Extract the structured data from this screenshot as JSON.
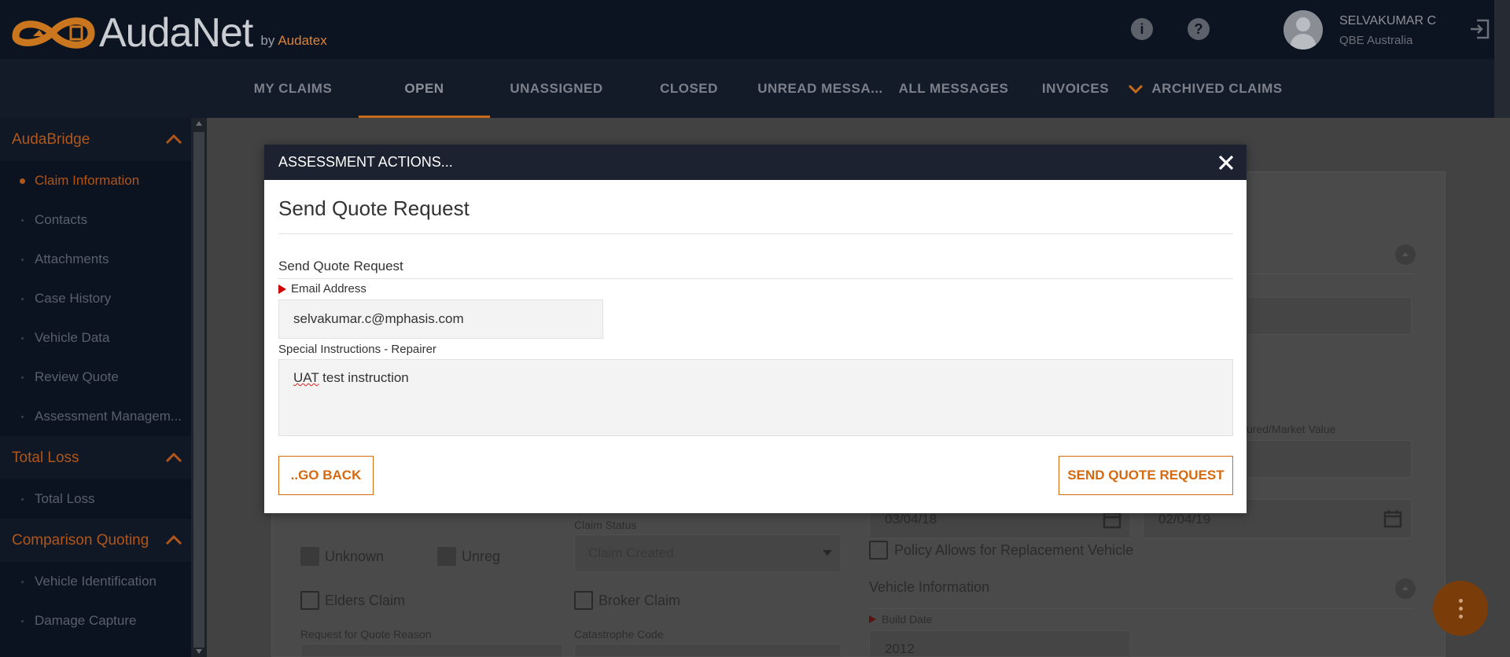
{
  "header": {
    "logo_text": "AudaNet",
    "logo_by": "by",
    "logo_brand": "Audatex",
    "info_icon": "info-icon",
    "help_icon": "help-icon",
    "help_glyph": "?",
    "info_glyph": "i",
    "user_name": "SELVAKUMAR C",
    "user_org": "QBE Australia"
  },
  "nav": {
    "tabs": [
      {
        "label": "MY CLAIMS"
      },
      {
        "label": "OPEN"
      },
      {
        "label": "UNASSIGNED"
      },
      {
        "label": "CLOSED"
      },
      {
        "label": "UNREAD MESSA..."
      },
      {
        "label": "ALL MESSAGES"
      },
      {
        "label": "INVOICES"
      },
      {
        "label": "ARCHIVED CLAIMS"
      }
    ],
    "active_tab": "OPEN"
  },
  "sidebar": {
    "sections": [
      {
        "title": "AudaBridge",
        "items": [
          {
            "label": "Claim Information"
          },
          {
            "label": "Contacts"
          },
          {
            "label": "Attachments"
          },
          {
            "label": "Case History"
          },
          {
            "label": "Vehicle Data"
          },
          {
            "label": "Review Quote"
          },
          {
            "label": "Assessment Managem..."
          }
        ]
      },
      {
        "title": "Total Loss",
        "items": [
          {
            "label": "Total Loss"
          }
        ]
      },
      {
        "title": "Comparison Quoting",
        "items": [
          {
            "label": "Vehicle Identification"
          },
          {
            "label": "Damage Capture"
          }
        ]
      }
    ]
  },
  "background": {
    "checkbox_unknown": "Unknown",
    "checkbox_unreg": "Unreg",
    "claim_status_label": "Claim Status",
    "claim_status_value": "Claim Created",
    "checkbox_elders": "Elders Claim",
    "checkbox_broker": "Broker Claim",
    "request_reason_label": "Request for Quote Reason",
    "catastrophe_label": "Catastrophe Code",
    "date1": "03/04/18",
    "date2": "02/04/19",
    "insured_label": "ured/Market Value",
    "policy_replacement": "Policy Allows for Replacement Vehicle",
    "vehicle_info": "Vehicle Information",
    "build_date_label": "Build Date",
    "build_date_value": "2012"
  },
  "modal": {
    "header": "ASSESSMENT ACTIONS...",
    "title": "Send Quote Request",
    "section_label": "Send Quote Request",
    "email_label": "Email Address",
    "email_value": "selvakumar.c@mphasis.com",
    "instructions_label": "Special Instructions - Repairer",
    "instructions_word1": "UAT",
    "instructions_rest": " test instruction",
    "go_back": "..GO BACK",
    "send": "SEND QUOTE REQUEST"
  },
  "colors": {
    "accent": "#d4690f",
    "header_bg": "#0d1421",
    "modal_header_bg": "#1c2230",
    "required": "#d10000"
  }
}
